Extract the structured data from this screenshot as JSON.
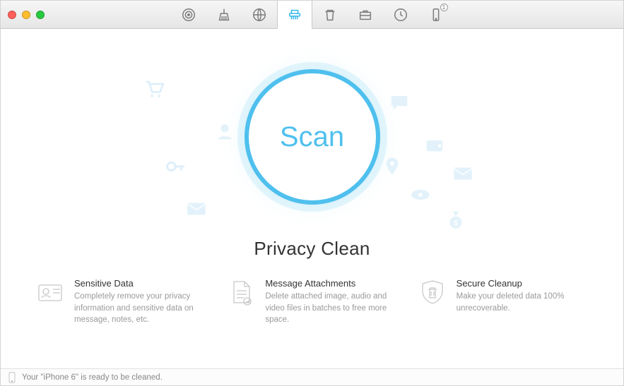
{
  "toolbar": {
    "tabs": [
      "target",
      "clean",
      "globe",
      "privacy",
      "trash",
      "toolbox",
      "restore",
      "device"
    ],
    "active_index": 3,
    "device_badge": "1"
  },
  "scan": {
    "button_label": "Scan"
  },
  "heading": "Privacy Clean",
  "features": [
    {
      "title": "Sensitive Data",
      "desc": "Completely remove your privacy information and sensitive data on message, notes, etc."
    },
    {
      "title": "Message Attachments",
      "desc": "Delete attached image, audio and video files in batches to free more space."
    },
    {
      "title": "Secure Cleanup",
      "desc": "Make your deleted data 100% unrecoverable."
    }
  ],
  "status": {
    "message": "Your \"iPhone 6\" is ready to be cleaned."
  }
}
